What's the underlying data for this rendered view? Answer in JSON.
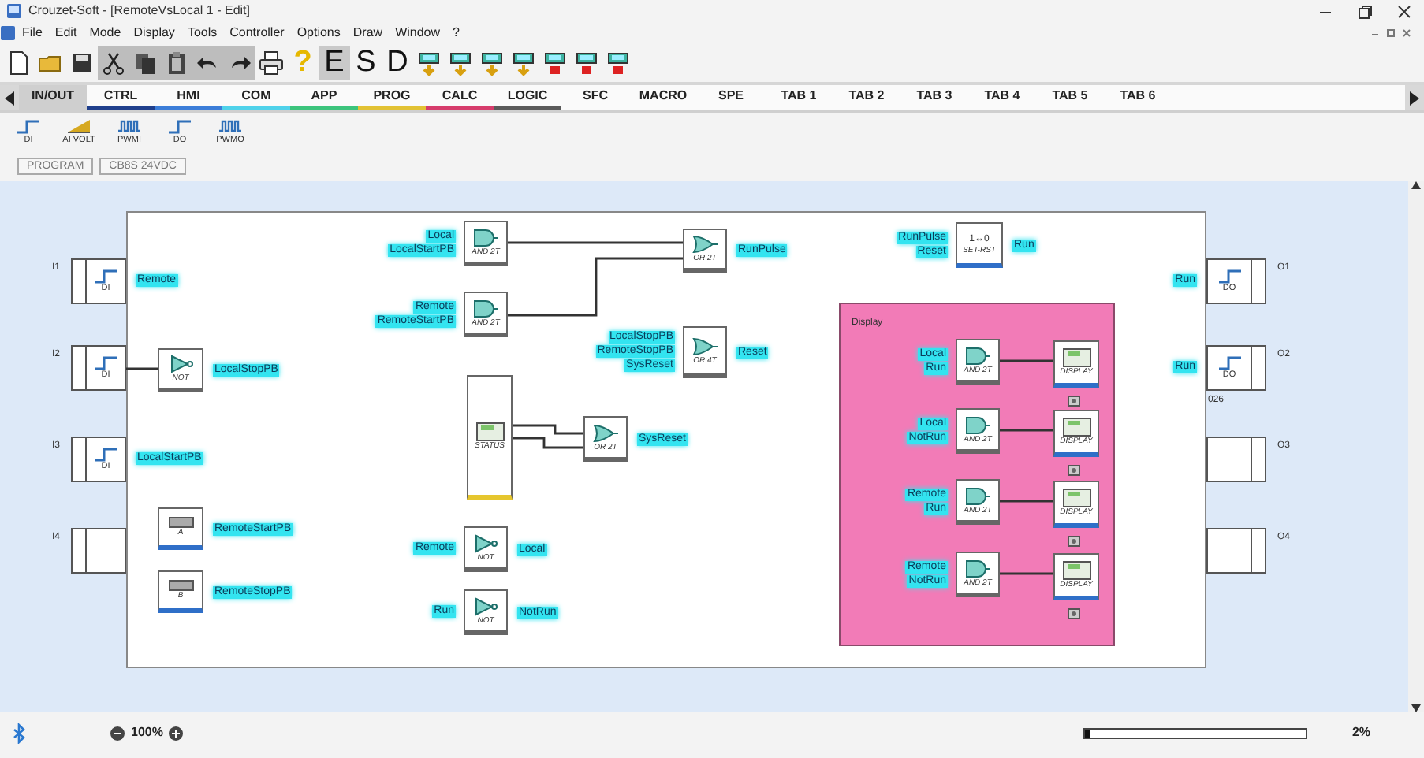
{
  "window": {
    "title": "Crouzet-Soft - [RemoteVsLocal 1 - Edit]"
  },
  "menu": [
    "File",
    "Edit",
    "Mode",
    "Display",
    "Tools",
    "Controller",
    "Options",
    "Draw",
    "Window",
    "?"
  ],
  "toolbar": {
    "help": "?",
    "mode_buttons": [
      {
        "label": "E",
        "selected": true
      },
      {
        "label": "S",
        "selected": false
      },
      {
        "label": "D",
        "selected": false
      }
    ]
  },
  "tabs": [
    {
      "label": "IN/OUT",
      "selected": true
    },
    {
      "label": "CTRL",
      "selected": false,
      "color": "#1f3f8c"
    },
    {
      "label": "HMI",
      "selected": false,
      "color": "#3b7dd8"
    },
    {
      "label": "COM",
      "selected": false,
      "color": "#4fd2ea"
    },
    {
      "label": "APP",
      "selected": false,
      "color": "#3cc47c"
    },
    {
      "label": "PROG",
      "selected": false,
      "color": "#e2c234"
    },
    {
      "label": "CALC",
      "selected": false,
      "color": "#d63c6c"
    },
    {
      "label": "LOGIC",
      "selected": false,
      "color": "#5a5a5a"
    },
    {
      "label": "SFC",
      "selected": false
    },
    {
      "label": "MACRO",
      "selected": false
    },
    {
      "label": "SPE",
      "selected": false
    },
    {
      "label": "TAB 1",
      "selected": false
    },
    {
      "label": "TAB 2",
      "selected": false
    },
    {
      "label": "TAB 3",
      "selected": false
    },
    {
      "label": "TAB 4",
      "selected": false
    },
    {
      "label": "TAB 5",
      "selected": false
    },
    {
      "label": "TAB 6",
      "selected": false
    }
  ],
  "palette": [
    {
      "label": "DI",
      "kind": "step"
    },
    {
      "label": "AI VOLT",
      "kind": "ramp"
    },
    {
      "label": "PWMI",
      "kind": "pulse"
    },
    {
      "label": "DO",
      "kind": "step"
    },
    {
      "label": "PWMO",
      "kind": "pulse"
    }
  ],
  "sheet_tabs": [
    "PROGRAM",
    "CB8S 24VDC"
  ],
  "diagram": {
    "inputs": [
      {
        "label": "I1",
        "kind": "di",
        "caption": "DI",
        "signal": "Remote"
      },
      {
        "label": "I2",
        "kind": "di",
        "caption": "DI"
      },
      {
        "label": "I3",
        "kind": "di",
        "caption": "DI",
        "signal": "LocalStartPB"
      },
      {
        "label": "I4",
        "kind": "empty"
      }
    ],
    "outputs": [
      {
        "label": "O1",
        "kind": "do",
        "caption": "DO",
        "signal": "Run"
      },
      {
        "label": "O2",
        "kind": "do",
        "caption": "DO",
        "signal": "Run",
        "note": "026"
      },
      {
        "label": "O3",
        "kind": "empty"
      },
      {
        "label": "O4",
        "kind": "empty"
      }
    ],
    "blocks": [
      {
        "kind": "and",
        "caption": "AND 2T",
        "inputs": [
          "Local",
          "LocalStartPB"
        ]
      },
      {
        "kind": "or",
        "caption": "OR 2T",
        "output": "RunPulse"
      },
      {
        "kind": "setreset",
        "symbol": "1↔0",
        "caption": "SET-RST",
        "inputs": [
          "RunPulse",
          "Reset"
        ],
        "output": "Run"
      },
      {
        "kind": "and",
        "caption": "AND 2T",
        "inputs": [
          "Remote",
          "RemoteStartPB"
        ]
      },
      {
        "kind": "not",
        "caption": "NOT",
        "output": "LocalStopPB"
      },
      {
        "kind": "or",
        "caption": "OR 4T",
        "inputs": [
          "LocalStopPB",
          "RemoteStopPB",
          "SysReset"
        ],
        "output": "Reset"
      },
      {
        "kind": "status",
        "caption": "STATUS"
      },
      {
        "kind": "or",
        "caption": "OR 2T",
        "output": "SysReset"
      },
      {
        "kind": "pushbutton",
        "caption": "A",
        "output": "RemoteStartPB"
      },
      {
        "kind": "not",
        "caption": "NOT",
        "inputs": [
          "Remote"
        ],
        "output": "Local"
      },
      {
        "kind": "pushbutton",
        "caption": "B",
        "output": "RemoteStopPB"
      },
      {
        "kind": "not",
        "caption": "NOT",
        "inputs": [
          "Run"
        ],
        "output": "NotRun"
      }
    ],
    "group": {
      "title": "Display",
      "rows": [
        {
          "inputs": [
            "Local",
            "Run"
          ],
          "caption": "AND 2T",
          "display": "DISPLAY"
        },
        {
          "inputs": [
            "Local",
            "NotRun"
          ],
          "caption": "AND 2T",
          "display": "DISPLAY"
        },
        {
          "inputs": [
            "Remote",
            "Run"
          ],
          "caption": "AND 2T",
          "display": "DISPLAY"
        },
        {
          "inputs": [
            "Remote",
            "NotRun"
          ],
          "caption": "AND 2T",
          "display": "DISPLAY"
        }
      ]
    }
  },
  "status_bar": {
    "zoom": "100%",
    "progress": {
      "level": 0.02,
      "reading": "2%"
    }
  }
}
